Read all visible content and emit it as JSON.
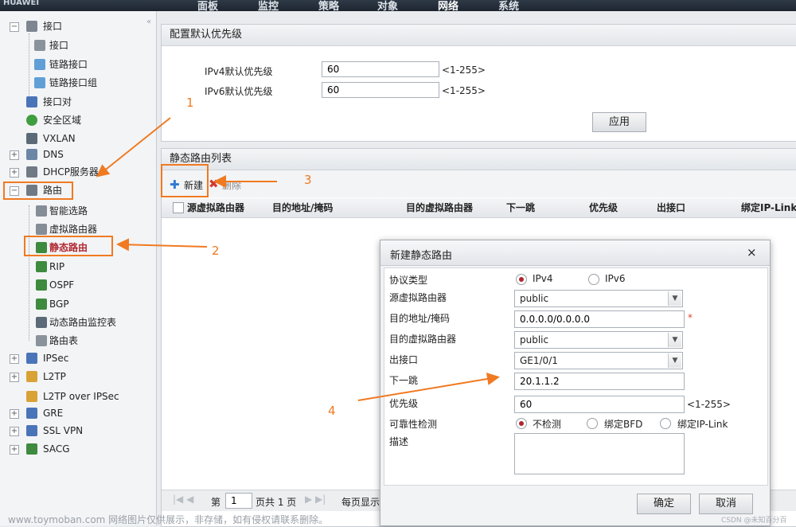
{
  "topbar": {
    "brand": "HUAWEI",
    "nav": [
      "面板",
      "监控",
      "策略",
      "对象",
      "网络",
      "系统"
    ]
  },
  "sidebar": {
    "items": [
      {
        "label": "接口"
      },
      {
        "label": "接口"
      },
      {
        "label": "链路接口"
      },
      {
        "label": "链路接口组"
      },
      {
        "label": "接口对"
      },
      {
        "label": "安全区域"
      },
      {
        "label": "VXLAN"
      },
      {
        "label": "DNS"
      },
      {
        "label": "DHCP服务器"
      },
      {
        "label": "路由"
      },
      {
        "label": "智能选路"
      },
      {
        "label": "虚拟路由器"
      },
      {
        "label": "静态路由"
      },
      {
        "label": "RIP"
      },
      {
        "label": "OSPF"
      },
      {
        "label": "BGP"
      },
      {
        "label": "动态路由监控表"
      },
      {
        "label": "路由表"
      },
      {
        "label": "IPSec"
      },
      {
        "label": "L2TP"
      },
      {
        "label": "L2TP over IPSec"
      },
      {
        "label": "GRE"
      },
      {
        "label": "SSL VPN"
      },
      {
        "label": "SACG"
      }
    ]
  },
  "priority": {
    "title": "配置默认优先级",
    "ipv4_label": "IPv4默认优先级",
    "ipv4_value": "60",
    "ipv4_hint": "<1-255>",
    "ipv6_label": "IPv6默认优先级",
    "ipv6_value": "60",
    "ipv6_hint": "<1-255>",
    "apply": "应用"
  },
  "routes": {
    "title": "静态路由列表",
    "new": "新建",
    "delete": "删除",
    "columns": [
      "源虚拟路由器",
      "目的地址/掩码",
      "目的虚拟路由器",
      "下一跳",
      "优先级",
      "出接口",
      "绑定IP-Link名"
    ],
    "pager": {
      "page_label": "第",
      "page_value": "1",
      "total": "页共 1 页",
      "per_page": "每页显示"
    }
  },
  "dialog": {
    "title": "新建静态路由",
    "close": "×",
    "protocol_label": "协议类型",
    "ipv4": "IPv4",
    "ipv6": "IPv6",
    "src_vr_label": "源虚拟路由器",
    "src_vr_value": "public",
    "dest_label": "目的地址/掩码",
    "dest_value": "0.0.0.0/0.0.0.0",
    "required": "*",
    "dst_vr_label": "目的虚拟路由器",
    "dst_vr_value": "public",
    "out_if_label": "出接口",
    "out_if_value": "GE1/0/1",
    "next_hop_label": "下一跳",
    "next_hop_value": "20.1.1.2",
    "priority_label": "优先级",
    "priority_value": "60",
    "priority_hint": "<1-255>",
    "detect_label": "可靠性检测",
    "detect_none": "不检测",
    "detect_bfd": "绑定BFD",
    "detect_iplink": "绑定IP-Link",
    "desc_label": "描述",
    "desc_value": "",
    "ok": "确定",
    "cancel": "取消"
  },
  "annotations": [
    "1",
    "2",
    "3",
    "4"
  ],
  "watermark": {
    "left": "www.toymoban.com 网络图片仅供展示，非存储，如有侵权请联系删除。",
    "right": "CSDN @未知百分百"
  },
  "colors": {
    "annotation": "#f07a21",
    "accent": "#b0262e"
  }
}
